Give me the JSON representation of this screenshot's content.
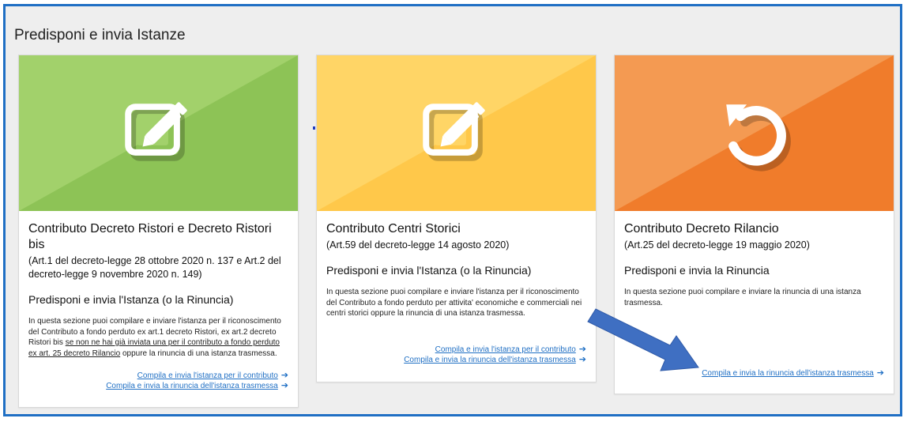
{
  "page": {
    "title": "Predisponi e invia Istanze"
  },
  "colors": {
    "frame_border": "#1f6fc4",
    "green_light": "#a2d16b",
    "green_dark": "#8dc356",
    "yellow_light": "#ffd566",
    "yellow_dark": "#ffc84a",
    "orange_light": "#f49a52",
    "orange_dark": "#f07c2b",
    "link": "#1f6fc4",
    "annotation_arrow": "#3f6fc2"
  },
  "cards": [
    {
      "icon": "edit-icon",
      "title": "Contributo Decreto Ristori e Decreto Ristori bis",
      "subtitle": "(Art.1 del decreto-legge 28 ottobre 2020 n. 137 e Art.2 del decreto-legge 9 novembre 2020 n. 149)",
      "action": "Predisponi e invia l'Istanza (o la Rinuncia)",
      "desc_a": "In questa sezione puoi compilare e inviare l'istanza per il riconoscimento del Contributo a fondo perduto ex art.1 decreto Ristori, ex art.2 decreto Ristori bis ",
      "desc_u": "se non ne hai già inviata una per il contributo a fondo perduto ex art. 25 decreto Rilancio",
      "desc_b": " oppure la rinuncia di una istanza trasmessa.",
      "link1": "Compila e invia l'istanza per il contributo",
      "link2": "Compila e invia la rinuncia dell'istanza trasmessa"
    },
    {
      "icon": "edit-icon",
      "title": "Contributo Centri Storici",
      "subtitle": "(Art.59 del decreto-legge 14 agosto 2020)",
      "action": "Predisponi e invia l'Istanza (o la Rinuncia)",
      "desc": "In questa sezione puoi compilare e inviare l'istanza per il riconoscimento del Contributo a fondo perduto per attivita' economiche e commerciali nei centri storici oppure la rinuncia di una istanza trasmessa.",
      "link1": "Compila e invia l'istanza per il contributo",
      "link2": "Compila e invia la rinuncia dell'istanza trasmessa"
    },
    {
      "icon": "undo-icon",
      "title": "Contributo Decreto Rilancio",
      "subtitle": "(Art.25 del decreto-legge 19 maggio 2020)",
      "action": "Predisponi e invia la Rinuncia",
      "desc": "In questa sezione puoi compilare e inviare la rinuncia di una istanza trasmessa.",
      "link1": "Compila e invia la rinuncia dell'istanza trasmessa"
    }
  ]
}
